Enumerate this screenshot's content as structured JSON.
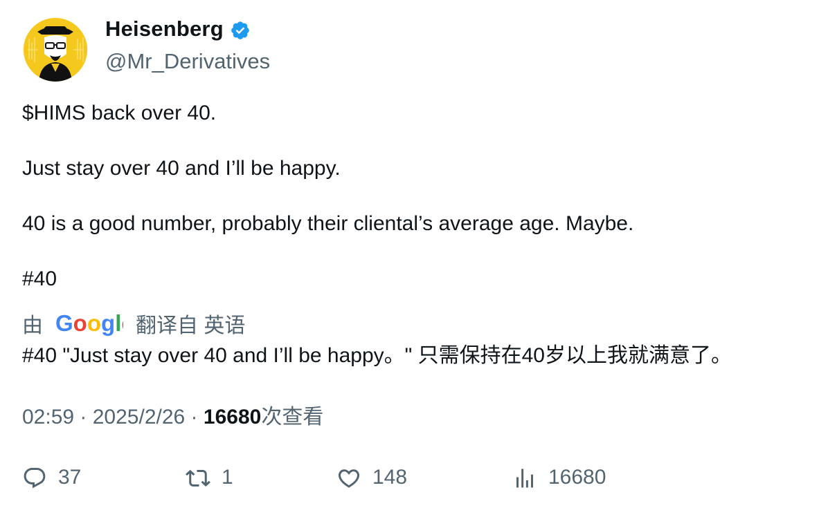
{
  "author": {
    "display_name": "Heisenberg",
    "handle": "@Mr_Derivatives",
    "verified": true,
    "avatar_icon": "heisenberg-avatar-icon"
  },
  "tweet": {
    "paragraphs": [
      "$HIMS back over 40.",
      "Just stay over 40 and I’ll be happy.",
      "40 is a good number, probably their cliental’s average age. Maybe.",
      "#40"
    ]
  },
  "translation": {
    "prefix": "由",
    "provider": "Google",
    "suffix": "翻译自 英语",
    "text": "#40 \"Just stay over 40 and I’ll be happy。\" 只需保持在40岁以上我就满意了。"
  },
  "meta": {
    "time": "02:59",
    "separator": " · ",
    "date": "2025/2/26",
    "views": "16680",
    "views_label": "次查看"
  },
  "actions": {
    "replies": "37",
    "retweets": "1",
    "likes": "148",
    "views": "16680"
  },
  "colors": {
    "text": "#0f1419",
    "secondary": "#536471",
    "verified_blue": "#1d9bf0",
    "avatar_bg": "#f4c81c"
  }
}
